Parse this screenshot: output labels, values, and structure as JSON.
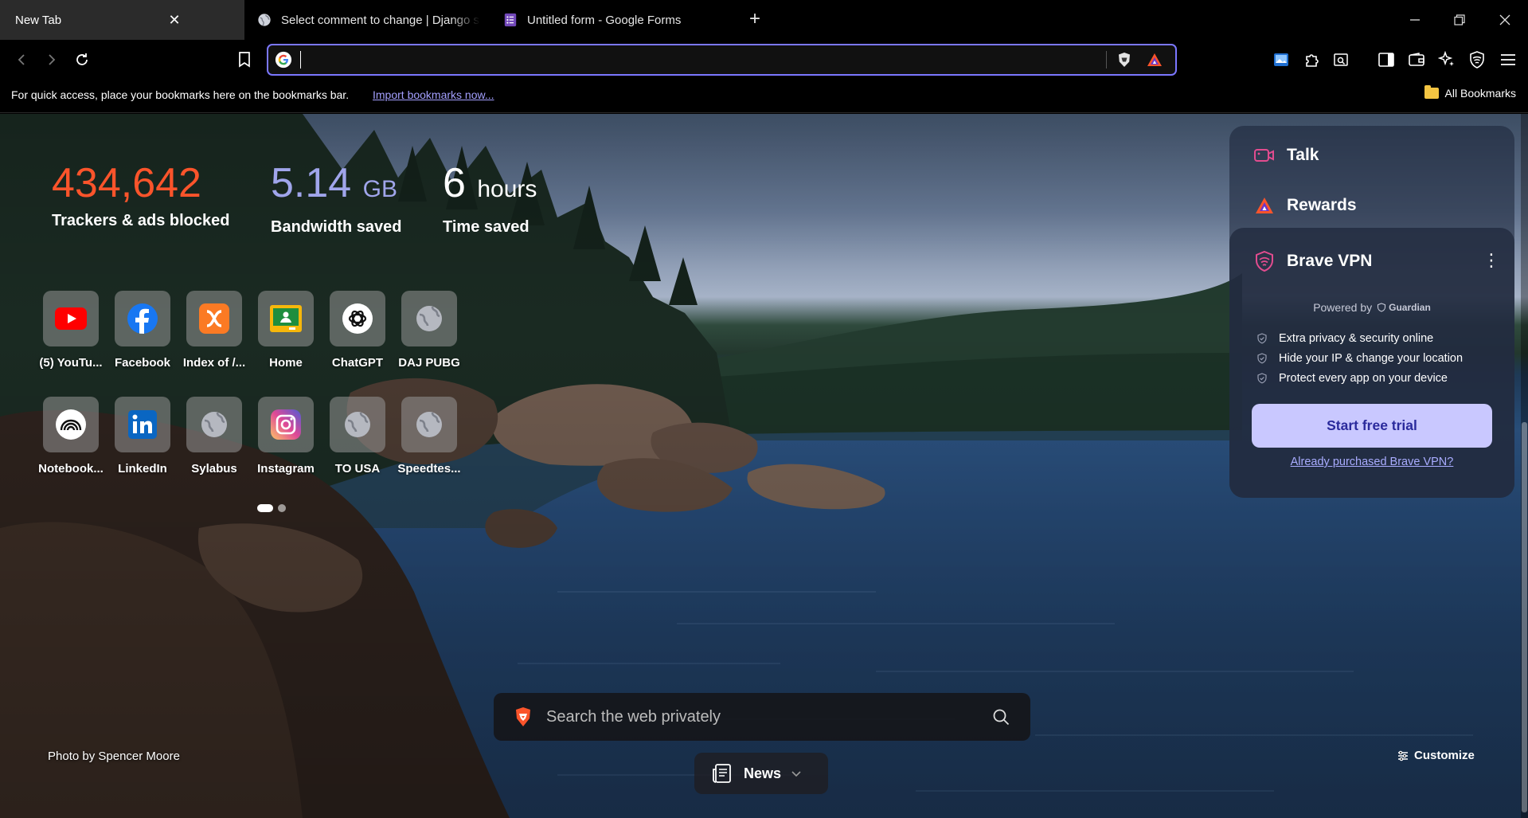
{
  "tabs": [
    {
      "title": "New Tab",
      "active": true
    },
    {
      "title": "Select comment to change | Django site admin",
      "active": false,
      "icon": "globe-icon"
    },
    {
      "title": "Untitled form - Google Forms",
      "active": false,
      "icon": "google-forms-icon"
    }
  ],
  "toolbar": {
    "address_value": "",
    "address_placeholder": ""
  },
  "bookmarks_bar": {
    "hint": "For quick access, place your bookmarks here on the bookmarks bar.",
    "import_link": "Import bookmarks now...",
    "all_bookmarks": "All Bookmarks"
  },
  "stats": {
    "trackers": {
      "value": "434,642",
      "label": "Trackers & ads blocked",
      "color": "#fb542b"
    },
    "bandwidth": {
      "value": "5.14",
      "unit": "GB",
      "label": "Bandwidth saved",
      "color": "#a0a5eb"
    },
    "time": {
      "value": "6",
      "unit": "hours",
      "label": "Time saved"
    }
  },
  "top_sites": [
    {
      "label": "(5) YouTu...",
      "icon": "youtube-icon"
    },
    {
      "label": "Facebook",
      "icon": "facebook-icon"
    },
    {
      "label": "Index of /...",
      "icon": "xampp-icon"
    },
    {
      "label": "Home",
      "icon": "google-classroom-icon"
    },
    {
      "label": "ChatGPT",
      "icon": "chatgpt-icon"
    },
    {
      "label": "DAJ PUBG",
      "icon": "globe-icon"
    },
    {
      "label": "Notebook...",
      "icon": "notebooklm-icon"
    },
    {
      "label": "LinkedIn",
      "icon": "linkedin-icon"
    },
    {
      "label": "Sylabus",
      "icon": "globe-icon"
    },
    {
      "label": "Instagram",
      "icon": "instagram-icon"
    },
    {
      "label": "TO USA",
      "icon": "globe-icon"
    },
    {
      "label": "Speedtes...",
      "icon": "globe-icon"
    }
  ],
  "widgets": {
    "talk": "Talk",
    "rewards": "Rewards",
    "vpn": {
      "title": "Brave VPN",
      "powered_by": "Powered by",
      "guardian": "Guardian",
      "features": [
        "Extra privacy & security online",
        "Hide your IP & change your location",
        "Protect every app on your device"
      ],
      "cta": "Start free trial",
      "already_purchased": "Already purchased Brave VPN?"
    }
  },
  "search": {
    "placeholder": "Search the web privately"
  },
  "photo_credit": "Photo by Spencer Moore",
  "news_label": "News",
  "customize_label": "Customize",
  "colors": {
    "accent": "#7b77ff",
    "brave_orange": "#fb542b"
  }
}
